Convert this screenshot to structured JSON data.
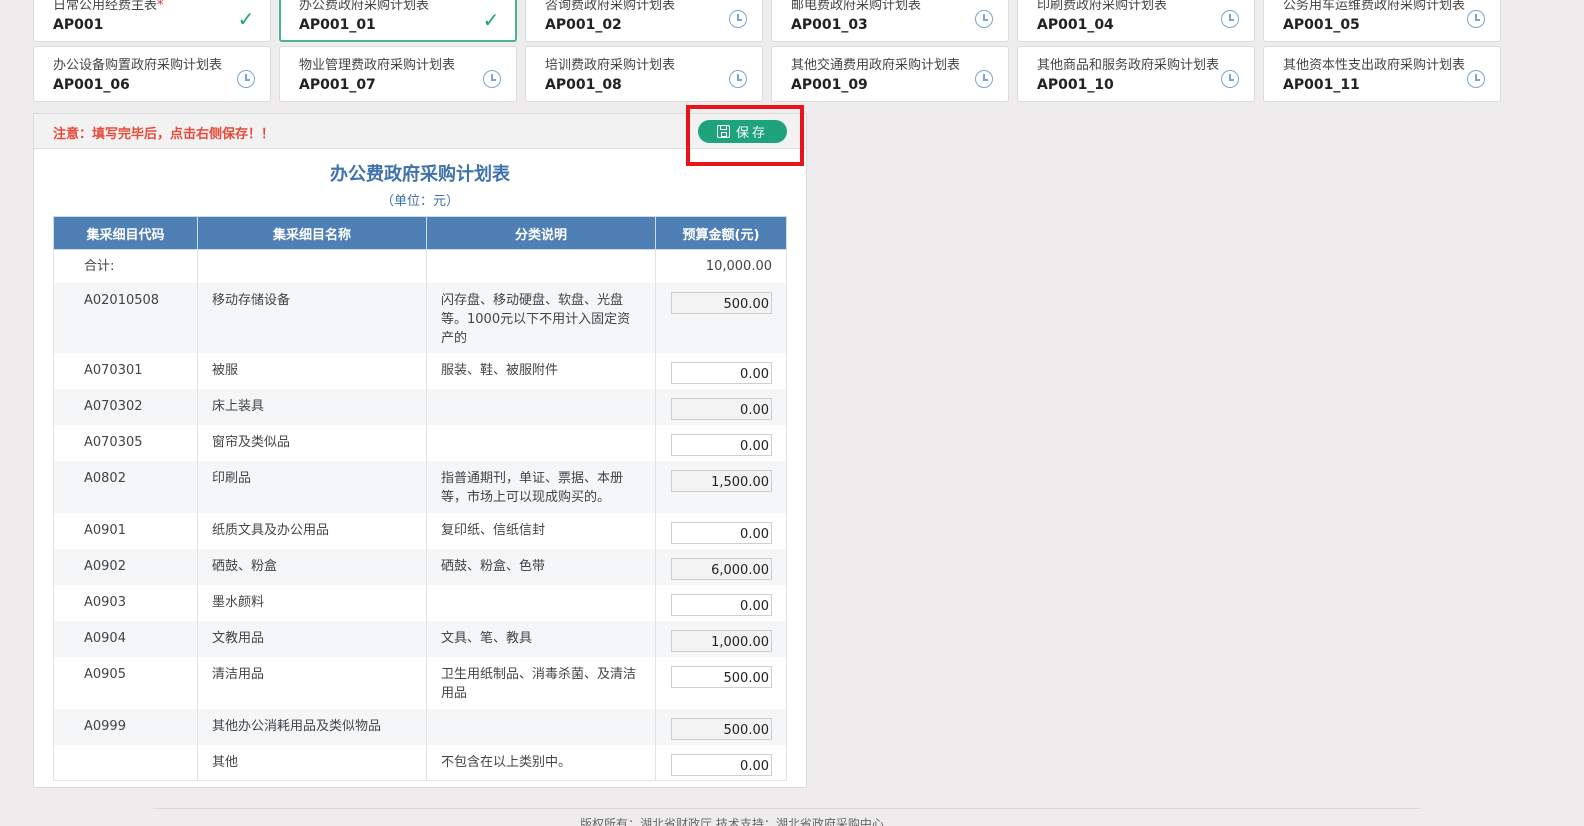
{
  "cards": [
    [
      {
        "name": "日常公用经费主表",
        "required": "*",
        "code": "AP001",
        "status": "done",
        "active": false
      },
      {
        "name": "办公费政府采购计划表",
        "required": "",
        "code": "AP001_01",
        "status": "done",
        "active": true
      },
      {
        "name": "咨询费政府采购计划表",
        "required": "",
        "code": "AP001_02",
        "status": "pending",
        "active": false
      },
      {
        "name": "邮电费政府采购计划表",
        "required": "",
        "code": "AP001_03",
        "status": "pending",
        "active": false
      },
      {
        "name": "印刷费政府采购计划表",
        "required": "",
        "code": "AP001_04",
        "status": "pending",
        "active": false
      },
      {
        "name": "公务用车运维费政府采购计划表",
        "required": "",
        "code": "AP001_05",
        "status": "pending",
        "active": false
      }
    ],
    [
      {
        "name": "办公设备购置政府采购计划表",
        "required": "",
        "code": "AP001_06",
        "status": "pending",
        "active": false
      },
      {
        "name": "物业管理费政府采购计划表",
        "required": "",
        "code": "AP001_07",
        "status": "pending",
        "active": false
      },
      {
        "name": "培训费政府采购计划表",
        "required": "",
        "code": "AP001_08",
        "status": "pending",
        "active": false
      },
      {
        "name": "其他交通费用政府采购计划表",
        "required": "",
        "code": "AP001_09",
        "status": "pending",
        "active": false
      },
      {
        "name": "其他商品和服务政府采购计划表",
        "required": "",
        "code": "AP001_10",
        "status": "pending",
        "active": false
      },
      {
        "name": "其他资本性支出政府采购计划表",
        "required": "",
        "code": "AP001_11",
        "status": "pending",
        "active": false
      }
    ]
  ],
  "panel": {
    "notice": "注意：填写完毕后，点击右侧保存！！",
    "save_label": "保存",
    "title": "办公费政府采购计划表",
    "unit": "（单位：元）"
  },
  "table": {
    "headers": [
      "集采细目代码",
      "集采细目名称",
      "分类说明",
      "预算金额(元)"
    ],
    "total": {
      "label": "合计:",
      "amount": "10,000.00"
    },
    "rows": [
      {
        "code": "A02010508",
        "name": "移动存储设备",
        "desc": "闪存盘、移动硬盘、软盘、光盘等。1000元以下不用计入固定资产的",
        "amount": "500.00"
      },
      {
        "code": "A070301",
        "name": "被服",
        "desc": "服装、鞋、被服附件",
        "amount": "0.00"
      },
      {
        "code": "A070302",
        "name": "床上装具",
        "desc": "",
        "amount": "0.00"
      },
      {
        "code": "A070305",
        "name": "窗帘及类似品",
        "desc": "",
        "amount": "0.00"
      },
      {
        "code": "A0802",
        "name": "印刷品",
        "desc": "指普通期刊，单证、票据、本册等，市场上可以现成购买的。",
        "amount": "1,500.00"
      },
      {
        "code": "A0901",
        "name": "纸质文具及办公用品",
        "desc": "复印纸、信纸信封",
        "amount": "0.00"
      },
      {
        "code": "A0902",
        "name": "硒鼓、粉盒",
        "desc": "硒鼓、粉盒、色带",
        "amount": "6,000.00"
      },
      {
        "code": "A0903",
        "name": "墨水颜料",
        "desc": "",
        "amount": "0.00"
      },
      {
        "code": "A0904",
        "name": "文教用品",
        "desc": "文具、笔、教具",
        "amount": "1,000.00"
      },
      {
        "code": "A0905",
        "name": "清洁用品",
        "desc": "卫生用纸制品、消毒杀菌、及清洁用品",
        "amount": "500.00"
      },
      {
        "code": "A0999",
        "name": "其他办公消耗用品及类似物品",
        "desc": "",
        "amount": "500.00"
      },
      {
        "code": "",
        "name": "其他",
        "desc": "不包含在以上类别中。",
        "amount": "0.00"
      }
    ]
  },
  "footer": {
    "text": "版权所有：湖北省财政厅  技术支持：湖北省政府采购中心"
  },
  "icons": {
    "done": "check-icon",
    "pending": "clock-icon",
    "save": "save-icon"
  },
  "colors": {
    "accent": "#1fa37a",
    "header": "#4e7fb5",
    "title": "#3f72ad",
    "notice": "#e64a3c",
    "highlight": "#e8141c"
  }
}
